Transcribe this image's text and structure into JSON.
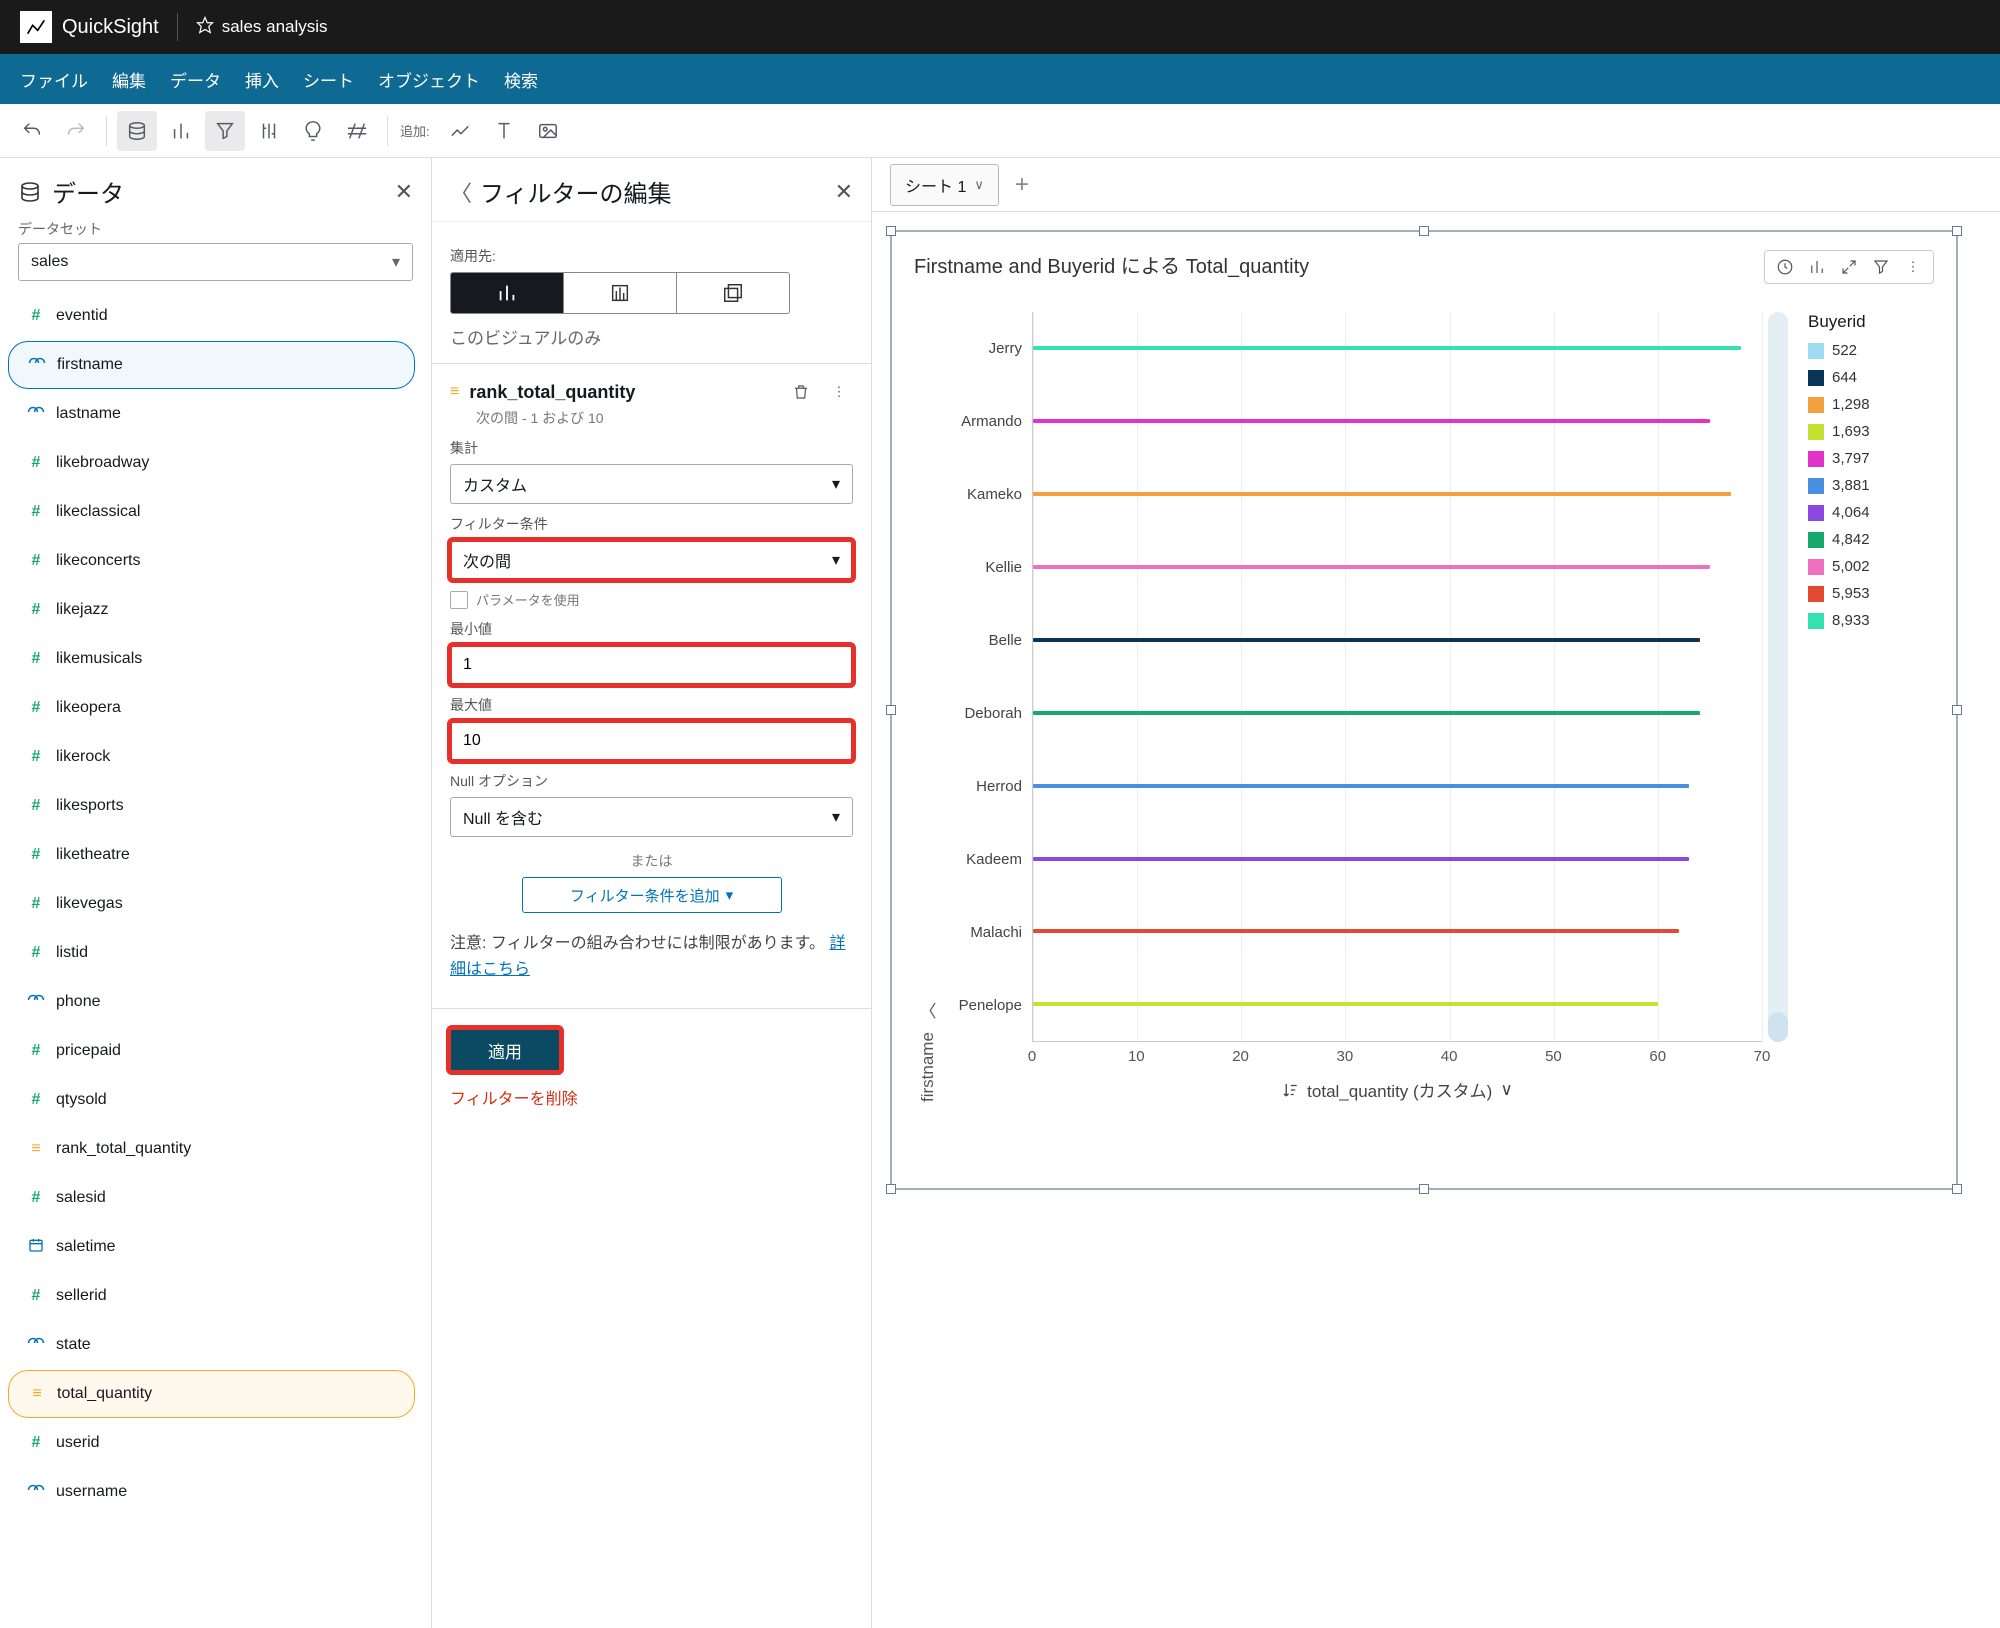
{
  "app_name": "QuickSight",
  "doc_title": "sales analysis",
  "menubar": [
    "ファイル",
    "編集",
    "データ",
    "挿入",
    "シート",
    "オブジェクト",
    "検索"
  ],
  "toolbar_add_label": "追加:",
  "left": {
    "title": "データ",
    "dataset_label": "データセット",
    "dataset_value": "sales",
    "fields": [
      {
        "name": "eventid",
        "type": "hash"
      },
      {
        "name": "firstname",
        "type": "str",
        "sel": "blue"
      },
      {
        "name": "lastname",
        "type": "str"
      },
      {
        "name": "likebroadway",
        "type": "hash"
      },
      {
        "name": "likeclassical",
        "type": "hash"
      },
      {
        "name": "likeconcerts",
        "type": "hash"
      },
      {
        "name": "likejazz",
        "type": "hash"
      },
      {
        "name": "likemusicals",
        "type": "hash"
      },
      {
        "name": "likeopera",
        "type": "hash"
      },
      {
        "name": "likerock",
        "type": "hash"
      },
      {
        "name": "likesports",
        "type": "hash"
      },
      {
        "name": "liketheatre",
        "type": "hash"
      },
      {
        "name": "likevegas",
        "type": "hash"
      },
      {
        "name": "listid",
        "type": "hash"
      },
      {
        "name": "phone",
        "type": "str"
      },
      {
        "name": "pricepaid",
        "type": "hash"
      },
      {
        "name": "qtysold",
        "type": "hash"
      },
      {
        "name": "rank_total_quantity",
        "type": "calc"
      },
      {
        "name": "salesid",
        "type": "hash"
      },
      {
        "name": "saletime",
        "type": "date"
      },
      {
        "name": "sellerid",
        "type": "hash"
      },
      {
        "name": "state",
        "type": "str"
      },
      {
        "name": "total_quantity",
        "type": "calc",
        "sel": "orange"
      },
      {
        "name": "userid",
        "type": "hash"
      },
      {
        "name": "username",
        "type": "str"
      }
    ]
  },
  "mid": {
    "title": "フィルターの編集",
    "apply_to_label": "適用先:",
    "scope_text": "このビジュアルのみ",
    "filter_name": "rank_total_quantity",
    "filter_sub": "次の間 - 1 および 10",
    "agg_label": "集計",
    "agg_value": "カスタム",
    "cond_label": "フィルター条件",
    "cond_value": "次の間",
    "use_param": "パラメータを使用",
    "min_label": "最小値",
    "min_value": "1",
    "max_label": "最大値",
    "max_value": "10",
    "null_label": "Null オプション",
    "null_value": "Null を含む",
    "or_label": "または",
    "add_cond": "フィルター条件を追加",
    "note1": "注意: フィルターの組み合わせには制限があります。",
    "note_link": "詳細はこちら",
    "apply": "適用",
    "delete": "フィルターを削除"
  },
  "tabs": {
    "tab1": "シート 1"
  },
  "visual": {
    "title": "Firstname and Buyerid による Total_quantity",
    "ylabel": "firstname",
    "xlabel": "total_quantity (カスタム)",
    "legend_title": "Buyerid"
  },
  "chart_data": {
    "type": "bar",
    "orientation": "horizontal",
    "ylabel": "firstname",
    "xlabel": "total_quantity (カスタム)",
    "xlim": [
      0,
      70
    ],
    "xticks": [
      0,
      10,
      20,
      30,
      40,
      50,
      60,
      70
    ],
    "categories": [
      "Jerry",
      "Armando",
      "Kameko",
      "Kellie",
      "Belle",
      "Deborah",
      "Herrod",
      "Kadeem",
      "Malachi",
      "Penelope"
    ],
    "series": [
      {
        "name": "522",
        "color": "#9edcf0",
        "values": {}
      },
      {
        "name": "644",
        "color": "#0b3556",
        "values": {
          "Belle": 64
        }
      },
      {
        "name": "1,298",
        "color": "#f2a23c",
        "values": {
          "Kameko": 67
        }
      },
      {
        "name": "1,693",
        "color": "#c4e233",
        "values": {
          "Penelope": 60
        }
      },
      {
        "name": "3,797",
        "color": "#e233c9",
        "values": {
          "Armando": 65
        }
      },
      {
        "name": "3,881",
        "color": "#4a90e2",
        "values": {
          "Herrod": 63
        }
      },
      {
        "name": "4,064",
        "color": "#8a4ae2",
        "values": {
          "Kadeem": 63
        }
      },
      {
        "name": "4,842",
        "color": "#18a86b",
        "values": {
          "Deborah": 64
        }
      },
      {
        "name": "5,002",
        "color": "#f070c0",
        "values": {
          "Kellie": 65
        }
      },
      {
        "name": "5,953",
        "color": "#e24a33",
        "values": {
          "Malachi": 62
        }
      },
      {
        "name": "8,933",
        "color": "#33e2b0",
        "values": {
          "Jerry": 68
        }
      }
    ]
  }
}
